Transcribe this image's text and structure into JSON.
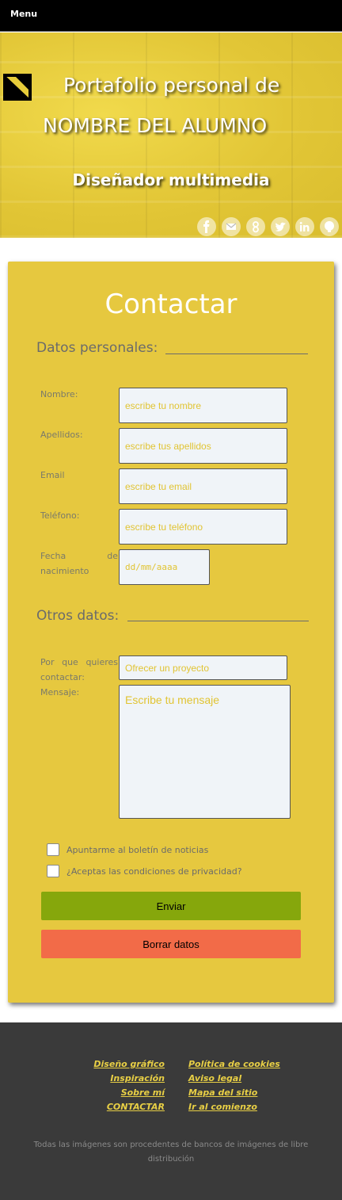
{
  "header": {
    "menu_label": "Menu"
  },
  "hero": {
    "title_line1": "Portafolio personal de",
    "title_line2": "NOMBRE DEL ALUMNO",
    "subtitle": "Diseñador multimedia",
    "social_icons": [
      "facebook-icon",
      "email-icon",
      "google-plus-icon",
      "twitter-icon",
      "linkedin-icon",
      "github-icon"
    ]
  },
  "form": {
    "title": "Contactar",
    "section_personal": "Datos personales:",
    "section_other": "Otros datos:",
    "fields": {
      "nombre": {
        "label": "Nombre:",
        "placeholder": "escribe tu nombre"
      },
      "apellidos": {
        "label": "Apellidos:",
        "placeholder": "escribe tus apellidos"
      },
      "email": {
        "label": "Email",
        "placeholder": "escribe tu email"
      },
      "telefono": {
        "label": "Teléfono:",
        "placeholder": "escribe tu teléfono"
      },
      "fecha": {
        "label_line1": "Fecha de",
        "label_line2": "nacimiento",
        "placeholder": "dd/mm/aaaa"
      },
      "motivo": {
        "label_line1": "Por que quieres",
        "label_line2": "contactar:",
        "value": "Ofrecer un proyecto"
      },
      "mensaje": {
        "label": "Mensaje:",
        "placeholder": "Escribe tu mensaje"
      }
    },
    "checkbox_newsletter": "Apuntarme al boletín de noticias",
    "checkbox_privacy": "¿Aceptas las condiciones de privacidad?",
    "submit_label": "Enviar",
    "reset_label": "Borrar datos",
    "colors": {
      "card": "#e6c83f",
      "submit": "#86a70c",
      "reset": "#f26b48"
    }
  },
  "footer": {
    "left_links": [
      "Diseño gráfico",
      "Inspiración",
      "Sobre mí",
      "CONTACTAR"
    ],
    "right_links": [
      "Política de cookies",
      "Aviso legal",
      "Mapa del sitio",
      "Ir al comienzo"
    ],
    "note": "Todas las imágenes son procedentes de bancos de imágenes de libre distribución"
  }
}
